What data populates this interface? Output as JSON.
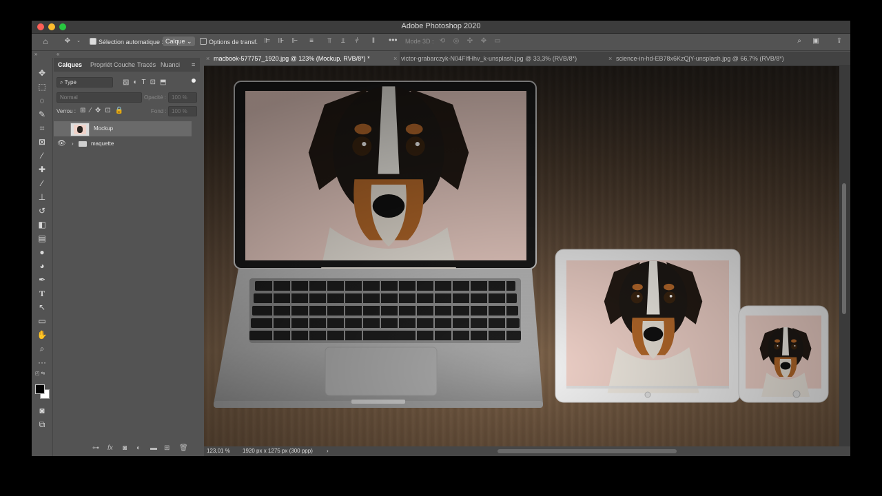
{
  "app": {
    "title": "Adobe Photoshop 2020"
  },
  "options_bar": {
    "auto_select_label": "Sélection automatique :",
    "auto_select_value": "Calque",
    "transform_label": "Options de transf.",
    "mode3d_label": "Mode 3D :"
  },
  "panel": {
    "tabs": [
      "Calques",
      "Propriét",
      "Couche",
      "Tracés",
      "Nuanci"
    ],
    "filter_label": "Type",
    "blend_mode": "Normal",
    "opacity_label": "Opacité :",
    "opacity_value": "100 %",
    "lock_label": "Verrou :",
    "fill_label": "Fond :",
    "fill_value": "100 %",
    "layers": [
      {
        "name": "Mockup",
        "selected": true,
        "visible": false
      },
      {
        "name": "maquette",
        "selected": false,
        "visible": true,
        "type": "group"
      }
    ]
  },
  "doc_tabs": [
    {
      "label": "macbook-577757_1920.jpg @ 123% (Mockup, RVB/8*) *",
      "active": true
    },
    {
      "label": "victor-grabarczyk-N04FIfHhv_k-unsplash.jpg @ 33,3% (RVB/8*)",
      "active": false
    },
    {
      "label": "science-in-hd-EB78x6KzQjY-unsplash.jpg @ 66,7% (RVB/8*)",
      "active": false
    }
  ],
  "status": {
    "zoom": "123,01 %",
    "doc_info": "1920 px x 1275 px (300 ppp)"
  },
  "colors": {
    "chrome": "#535353",
    "dark_chrome": "#424242",
    "mac_red": "#ff5f57",
    "mac_yellow": "#febc2e",
    "mac_green": "#28c840",
    "screen_bg": "#f0d2c9"
  }
}
